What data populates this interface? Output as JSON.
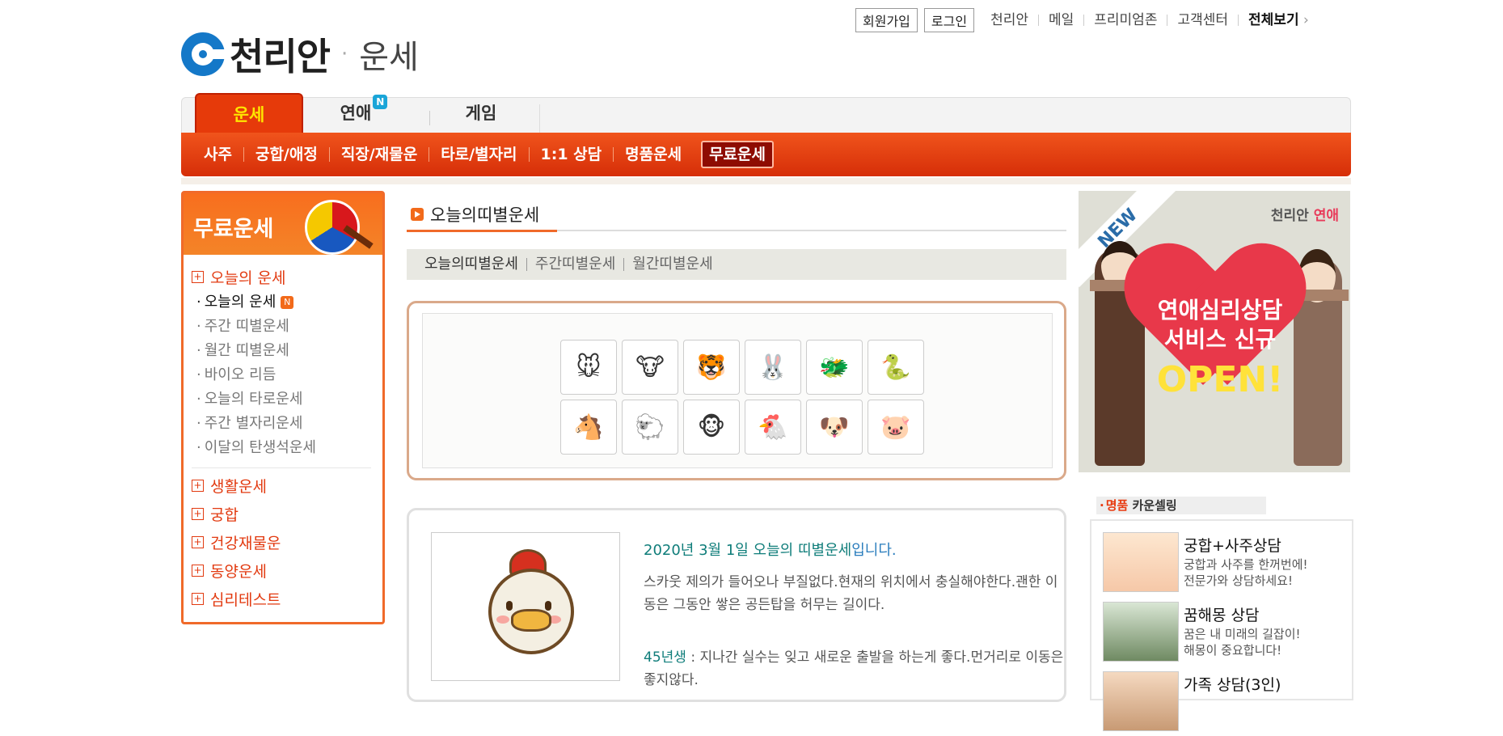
{
  "brand": {
    "name": "천리안",
    "sep": "·",
    "section": "운세"
  },
  "topnav": {
    "join": "회원가입",
    "login": "로그인",
    "links": [
      "천리안",
      "메일",
      "프리미엄존",
      "고객센터"
    ],
    "all": "전체보기"
  },
  "tabs": {
    "t1": "운세",
    "t2": "연애",
    "t2_badge": "N",
    "t3": "게임"
  },
  "subnav": [
    "사주",
    "궁합/애정",
    "직장/재물운",
    "타로/별자리",
    "1:1 상담",
    "명품운세",
    "무료운세"
  ],
  "sidebar": {
    "title": "무료운세",
    "cat_today": "오늘의 운세",
    "items": [
      "오늘의 운세",
      "주간 띠별운세",
      "월간 띠별운세",
      "바이오 리듬",
      "오늘의 타로운세",
      "주간 별자리운세",
      "이달의 탄생석운세"
    ],
    "new_badge": "N",
    "cats": [
      "생활운세",
      "궁합",
      "건강재물운",
      "동양운세",
      "심리테스트"
    ]
  },
  "center": {
    "title": "오늘의띠별운세",
    "subtabs": [
      "오늘의띠별운세",
      "주간띠별운세",
      "월간띠별운세"
    ],
    "animals": [
      "rat-icon",
      "ox-icon",
      "tiger-icon",
      "rabbit-icon",
      "dragon-icon",
      "snake-icon",
      "horse-icon",
      "sheep-icon",
      "monkey-icon",
      "rooster-icon",
      "dog-icon",
      "pig-icon"
    ],
    "fortune_title": "2020년 3월 1일 오늘의 띠별운세",
    "fortune_title_suffix": "입니다.",
    "fortune_text": "스카웃 제의가 들어오나 부질없다.현재의 위치에서 충실해야한다.괜한 이동은 그동안 쌓은 공든탑을 허무는 길이다.",
    "year_label": "45년생",
    "year_text": " : 지나간 실수는 잊고 새로운 출발을 하는게 좋다.먼거리로 이동은 좋지않다."
  },
  "banner": {
    "new": "NEW",
    "brand": "천리안",
    "brand_suffix": "연애",
    "line1": "연애심리상담",
    "line2": "서비스 신규",
    "line3": "OPEN!"
  },
  "counsel": {
    "label_red": "명품",
    "label": " 카운셀링",
    "items": [
      {
        "title": "궁합+사주상담",
        "desc": "궁합과 사주를 한꺼번에!\n전문가와 상담하세요!"
      },
      {
        "title": "꿈해몽 상담",
        "desc": "꿈은 내 미래의 길잡이!\n해몽이 중요합니다!"
      },
      {
        "title": "가족 상담(3인)",
        "desc": ""
      }
    ]
  }
}
